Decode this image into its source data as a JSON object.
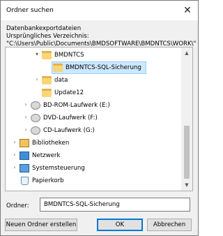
{
  "window": {
    "title": "Ordner suchen"
  },
  "description": {
    "line1": "Datenbankexportdateien",
    "line2": "Ursprüngliches Verzeichnis:",
    "line3": "\"C:\\Users\\Public\\Documents\\BMDSOFTWARE\\BMDNTCS\\WORK\\\""
  },
  "tree": {
    "items": [
      {
        "label": "BMDNTCS",
        "icon": "folder-icon",
        "expanded": true
      },
      {
        "label": "BMDNTCS-SQL-Sicherung",
        "icon": "folder-icon",
        "selected": true
      },
      {
        "label": "data",
        "icon": "folder-icon"
      },
      {
        "label": "Update12",
        "icon": "folder-icon"
      },
      {
        "label": "BD-ROM-Laufwerk (E:)",
        "icon": "disc-drive-icon"
      },
      {
        "label": "DVD-Laufwerk (F:)",
        "icon": "disc-drive-icon"
      },
      {
        "label": "CD-Laufwerk (G:)",
        "icon": "disc-drive-icon"
      },
      {
        "label": "Bibliotheken",
        "icon": "libraries-icon"
      },
      {
        "label": "Netzwerk",
        "icon": "network-icon"
      },
      {
        "label": "Systemsteuerung",
        "icon": "control-panel-icon"
      },
      {
        "label": "Papierkorb",
        "icon": "recycle-bin-icon"
      }
    ]
  },
  "folder_field": {
    "label": "Ordner:",
    "value": "BMDNTCS-SQL-Sicherung"
  },
  "buttons": {
    "new_folder": "Neuen Ordner erstellen",
    "ok": "OK",
    "cancel": "Abbrechen"
  }
}
